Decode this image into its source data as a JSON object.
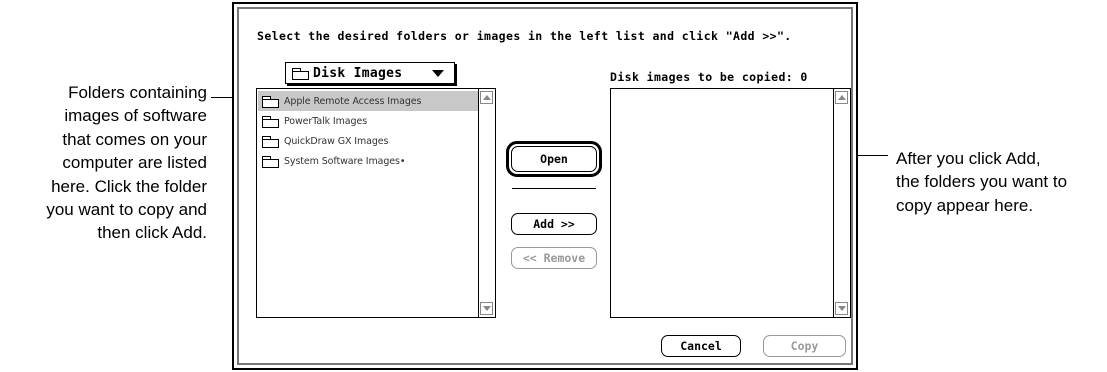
{
  "callouts": {
    "left_lines": [
      "Folders containing",
      "images of software",
      "that comes on your",
      "computer are listed",
      "here. Click the folder",
      "you want to copy and",
      "then click Add."
    ],
    "right_lines": [
      "After you click Add,",
      "the folders you want to",
      "copy appear here."
    ]
  },
  "dialog": {
    "instruction": "Select the desired folders or images in the left list and click \"Add >>\".",
    "popup": {
      "icon": "folder-icon",
      "label": "Disk Images"
    },
    "source_list": {
      "items": [
        {
          "label": "Apple Remote Access Images",
          "selected": true
        },
        {
          "label": "PowerTalk Images",
          "selected": false
        },
        {
          "label": "QuickDraw GX Images",
          "selected": false
        },
        {
          "label": "System Software Images•",
          "selected": false
        }
      ]
    },
    "dest_title": "Disk images to be copied: 0",
    "buttons": {
      "open": "Open",
      "add": "Add >>",
      "remove": "<< Remove",
      "cancel": "Cancel",
      "copy": "Copy"
    },
    "button_states": {
      "remove_enabled": false,
      "copy_enabled": false,
      "open_default": true
    }
  }
}
